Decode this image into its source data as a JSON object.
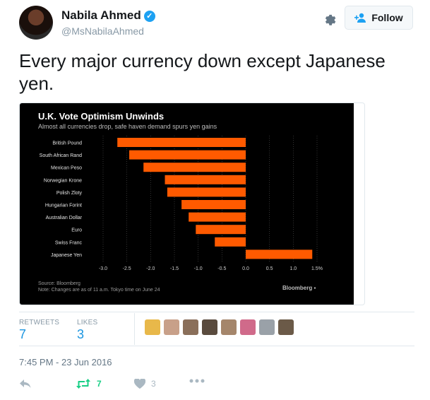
{
  "user": {
    "name": "Nabila Ahmed",
    "handle": "@MsNabilaAhmed",
    "verified": true
  },
  "follow_button": {
    "label": "Follow"
  },
  "tweet": {
    "text": "Every major currency down except Japanese yen."
  },
  "chart_data": {
    "type": "bar",
    "orientation": "horizontal",
    "title": "U.K. Vote Optimism Unwinds",
    "subtitle": "Almost all currencies drop, safe haven demand spurs yen gains",
    "categories": [
      "British Pound",
      "South African Rand",
      "Mexican Peso",
      "Norwegian Krone",
      "Polish Zloty",
      "Hungarian Forint",
      "Australian Dollar",
      "Euro",
      "Swiss Franc",
      "Japanese Yen"
    ],
    "values": [
      -2.7,
      -2.45,
      -2.15,
      -1.7,
      -1.65,
      -1.35,
      -1.2,
      -1.05,
      -0.65,
      1.4
    ],
    "xlim": [
      -3.0,
      1.5
    ],
    "xticks": [
      "-3.0",
      "-2.5",
      "-2.0",
      "-1.5",
      "-1.0",
      "-0.5",
      "0.0",
      "0.5",
      "1.0",
      "1.5%"
    ],
    "xtick_values": [
      -3.0,
      -2.5,
      -2.0,
      -1.5,
      -1.0,
      -0.5,
      0.0,
      0.5,
      1.0,
      1.5
    ],
    "bar_color": "#ff5a00",
    "background": "#000000",
    "source": "Source: Bloomberg",
    "note": "Note: Changes are as of 11 a.m. Tokyo time on June 24",
    "logo": "Bloomberg"
  },
  "stats": {
    "retweets_label": "RETWEETS",
    "retweets_count": "7",
    "likes_label": "LIKES",
    "likes_count": "3"
  },
  "likers": [
    {
      "name": "liker-1",
      "color": "#e8b84a"
    },
    {
      "name": "liker-2",
      "color": "#c8a089"
    },
    {
      "name": "liker-3",
      "color": "#8a6f5a"
    },
    {
      "name": "liker-4",
      "color": "#5a4b3e"
    },
    {
      "name": "liker-5",
      "color": "#a5866b"
    },
    {
      "name": "liker-6",
      "color": "#d06a8a"
    },
    {
      "name": "liker-7",
      "color": "#9aa1a8"
    },
    {
      "name": "liker-8",
      "color": "#6b5a48"
    }
  ],
  "timestamp": "7:45 PM - 23 Jun 2016",
  "actions": {
    "retweet_count": "7",
    "like_count": "3"
  },
  "colors": {
    "accent": "#1da1f2",
    "retweet": "#19cf86",
    "muted": "#8899a6"
  }
}
